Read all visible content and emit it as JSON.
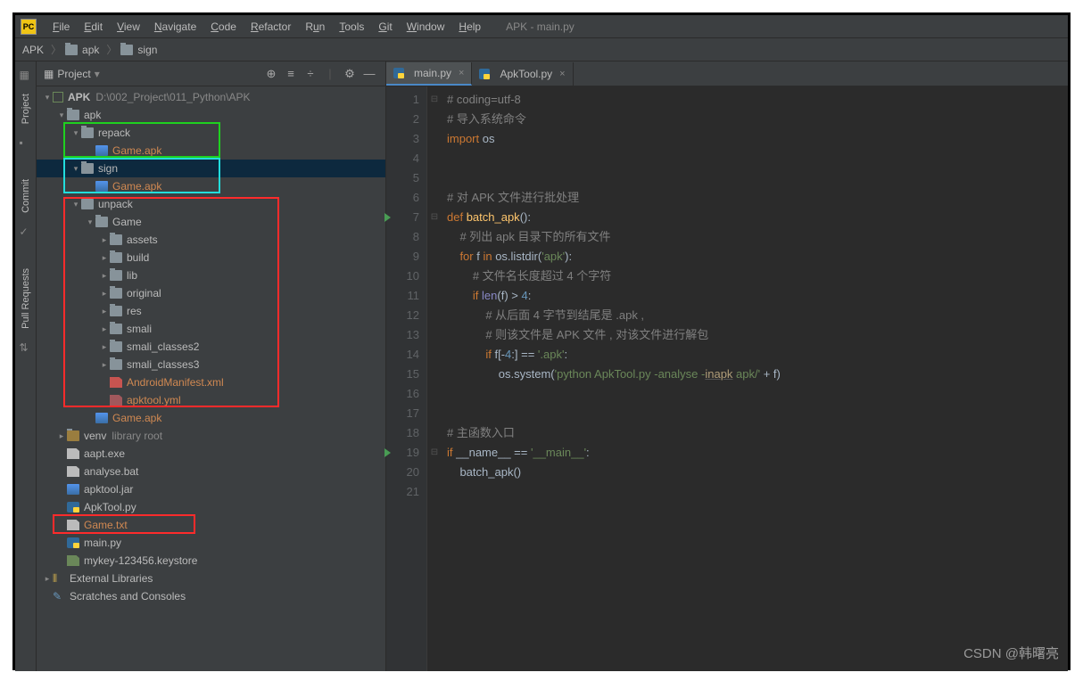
{
  "menu": {
    "file": "File",
    "edit": "Edit",
    "view": "View",
    "navigate": "Navigate",
    "code": "Code",
    "refactor": "Refactor",
    "run": "Run",
    "tools": "Tools",
    "git": "Git",
    "window": "Window",
    "help": "Help",
    "context": "APK - main.py"
  },
  "breadcrumbs": {
    "root": "APK",
    "p1": "apk",
    "p2": "sign",
    "chev": "〉"
  },
  "panel": {
    "title": "Project"
  },
  "sidebar": {
    "project": "Project",
    "commit": "Commit",
    "pull": "Pull Requests"
  },
  "tree": {
    "root": "APK",
    "root_path": "D:\\002_Project\\011_Python\\APK",
    "apk": "apk",
    "repack": "repack",
    "repack_game": "Game.apk",
    "sign": "sign",
    "sign_game": "Game.apk",
    "unpack": "unpack",
    "game": "Game",
    "assets": "assets",
    "build": "build",
    "lib": "lib",
    "original": "original",
    "res": "res",
    "smali": "smali",
    "smali2": "smali_classes2",
    "smali3": "smali_classes3",
    "manifest": "AndroidManifest.xml",
    "apktool_yml": "apktool.yml",
    "game_apk": "Game.apk",
    "venv": "venv",
    "venv_note": "library root",
    "aapt": "aapt.exe",
    "analyse": "analyse.bat",
    "apktool_jar": "apktool.jar",
    "apktool_py": "ApkTool.py",
    "game_txt": "Game.txt",
    "main_py": "main.py",
    "keystore": "mykey-123456.keystore",
    "ext": "External Libraries",
    "scratch": "Scratches and Consoles"
  },
  "tabs": {
    "t1": "main.py",
    "t2": "ApkTool.py"
  },
  "code": {
    "l1": "# coding=utf-8",
    "l2": "# 导入系统命令",
    "l3_kw": "import",
    "l3_mod": " os",
    "l5": "# 对 APK 文件进行批处理",
    "l6_def": "def ",
    "l6_fn": "batch_apk",
    "l6_p": "():",
    "l7": "    # 列出 apk 目录下的所有文件",
    "l8_for": "    for ",
    "l8_f": "f ",
    "l8_in": "in ",
    "l8_os": "os.listdir(",
    "l8_s": "'apk'",
    "l8_e": "):",
    "l9": "        # 文件名长度超过 4 个字符",
    "l10_if": "        if ",
    "l10_len": "len",
    "l10_m": "(f) > ",
    "l10_n": "4",
    "l10_c": ":",
    "l11": "            # 从后面 4 字节到结尾是 .apk ,",
    "l12": "            # 则该文件是 APK 文件 , 对该文件进行解包",
    "l13_if": "            if ",
    "l13_f": "f[-",
    "l13_n": "4",
    "l13_s": ":] == ",
    "l13_str": "'.apk'",
    "l13_c": ":",
    "l14_pre": "                os.system(",
    "l14_s1": "'python ApkTool.py -analyse -",
    "l14_u": "inapk",
    "l14_s2": " apk/'",
    "l14_post": " + f)",
    "l16": "# 主函数入口",
    "l17_if": "if ",
    "l17_n": "__name__ == ",
    "l17_s": "'__main__'",
    "l17_c": ":",
    "l18": "    batch_apk()"
  },
  "lines": [
    "1",
    "2",
    "3",
    "4",
    "5",
    "6",
    "7",
    "8",
    "9",
    "10",
    "11",
    "12",
    "13",
    "14",
    "15",
    "16",
    "17",
    "18",
    "19",
    "20",
    "21"
  ],
  "watermark": "CSDN @韩曙亮"
}
